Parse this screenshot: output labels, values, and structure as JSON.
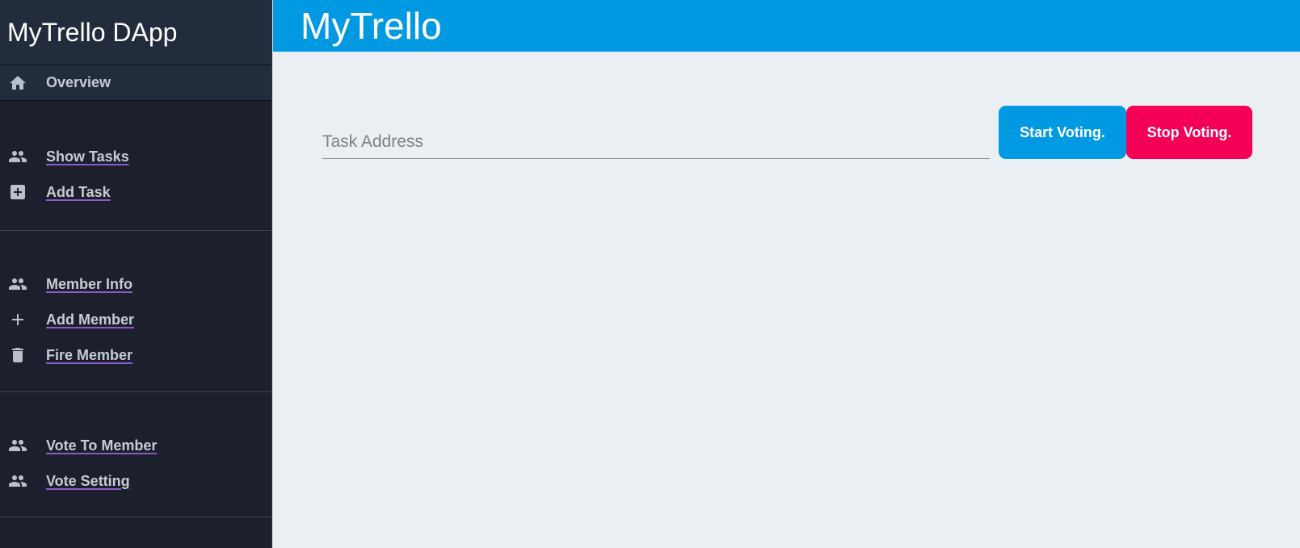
{
  "sidebar": {
    "brand": "MyTrello DApp",
    "overview": {
      "label": "Overview",
      "icon": "home-icon"
    },
    "groups": [
      {
        "items": [
          {
            "label": "Show Tasks",
            "icon": "people-icon"
          },
          {
            "label": "Add Task",
            "icon": "add-box-icon"
          }
        ]
      },
      {
        "items": [
          {
            "label": "Member Info",
            "icon": "people-icon"
          },
          {
            "label": "Add Member",
            "icon": "plus-icon"
          },
          {
            "label": "Fire Member",
            "icon": "trash-icon"
          }
        ]
      },
      {
        "items": [
          {
            "label": "Vote To Member",
            "icon": "people-icon"
          },
          {
            "label": "Vote Setting",
            "icon": "people-icon"
          }
        ]
      }
    ]
  },
  "header": {
    "title": "MyTrello"
  },
  "main": {
    "task_address": {
      "placeholder": "Task Address",
      "value": ""
    },
    "start_label": "Start Voting.",
    "stop_label": "Stop Voting."
  },
  "colors": {
    "accent": "#0299e3",
    "danger": "#f50057",
    "sidebar_bg": "#1b202c",
    "content_bg": "#e9eff2"
  }
}
